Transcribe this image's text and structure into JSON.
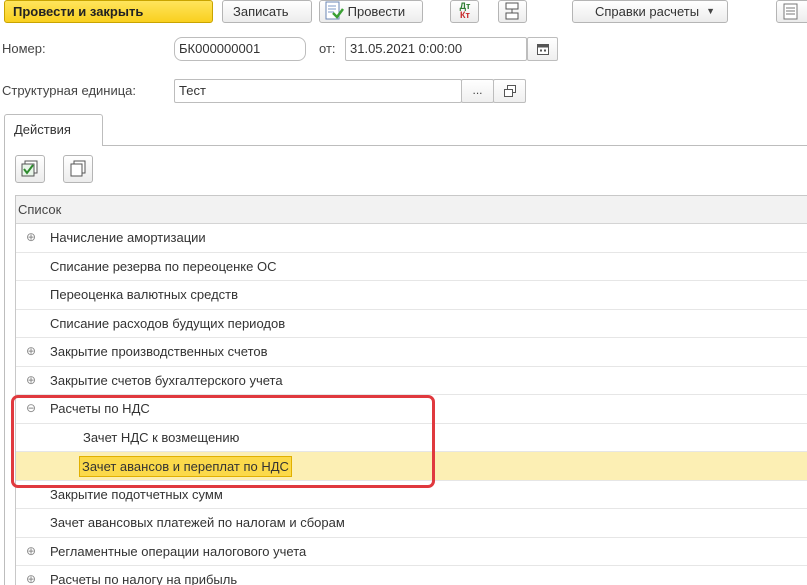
{
  "toolbar": {
    "post_close_label": "Провести и закрыть",
    "save_label": "Записать",
    "post_label": "Провести",
    "dt_kt_top": "Дт",
    "dt_kt_bottom": "Кт",
    "reports_label": "Справки расчеты"
  },
  "form": {
    "number_label": "Номер:",
    "number_value": "БК000000001",
    "from_label": "от:",
    "date_value": "31.05.2021  0:00:00",
    "unit_label": "Структурная единица:",
    "unit_value": "Тест",
    "select_button": "..."
  },
  "tabs": [
    {
      "label": "Действия"
    }
  ],
  "list": {
    "header": "Список",
    "rows": [
      {
        "label": "Начисление амортизации",
        "expander": "⊕"
      },
      {
        "label": "Списание резерва по переоценке ОС",
        "expander": ""
      },
      {
        "label": "Переоценка валютных средств",
        "expander": ""
      },
      {
        "label": "Списание расходов будущих периодов",
        "expander": ""
      },
      {
        "label": "Закрытие производственных счетов",
        "expander": "⊕"
      },
      {
        "label": "Закрытие счетов бухгалтерского учета",
        "expander": "⊕"
      },
      {
        "label": "Расчеты по НДС",
        "expander": "⊖"
      },
      {
        "label": "Зачет НДС к возмещению",
        "expander": ""
      },
      {
        "label": "Зачет авансов и переплат по НДС",
        "expander": ""
      },
      {
        "label": "Закрытие подотчетных сумм",
        "expander": ""
      },
      {
        "label": "Зачет авансовых платежей по налогам и сборам",
        "expander": ""
      },
      {
        "label": "Регламентные операции налогового учета",
        "expander": "⊕"
      },
      {
        "label": "Расчеты по налогу на прибыль",
        "expander": "⊕"
      }
    ],
    "selected_row": "Зачет авансов и переплат по НДС"
  },
  "colors": {
    "primary_button": "#f9d01f",
    "selection": "#fbd94a",
    "highlight_border": "#e0393e"
  }
}
